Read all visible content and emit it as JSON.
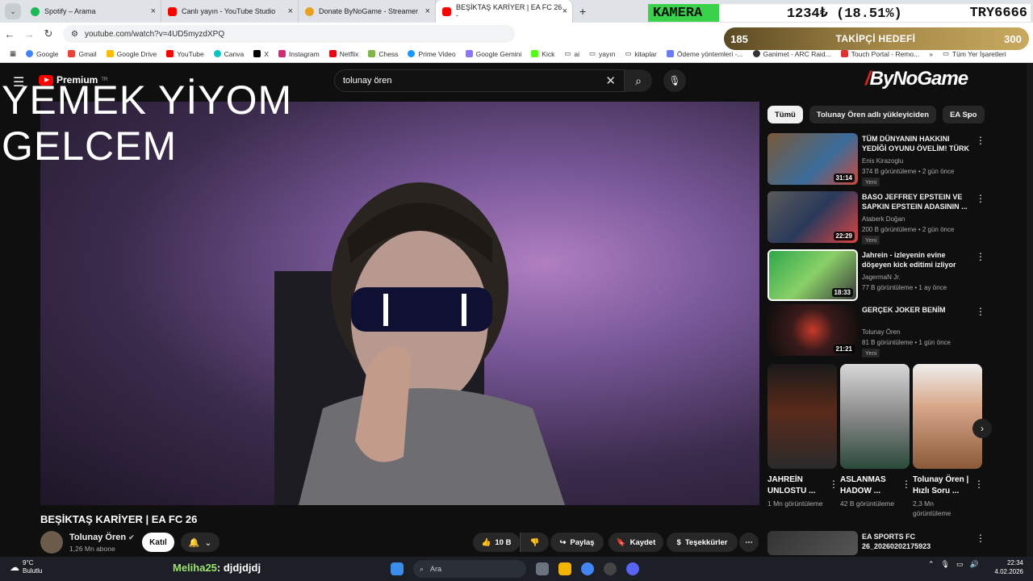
{
  "browser": {
    "tabs": [
      {
        "title": "Spotify – Arama",
        "color": "#1db954"
      },
      {
        "title": "Canlı yayın - YouTube Studio",
        "color": "#ff0000"
      },
      {
        "title": "Donate ByNoGame - Streamer",
        "color": "#e8a020"
      },
      {
        "title": "BEŞİKTAŞ KARİYER | EA FC 26 -",
        "color": "#ff0000"
      }
    ],
    "url": "youtube.com/watch?v=4UD5myzdXPQ",
    "bookmarks": [
      "Google",
      "Gmail",
      "Google Drive",
      "YouTube",
      "Canva",
      "X",
      "Instagram",
      "Netflix",
      "Chess",
      "Prime Video",
      "Google Gemini",
      "Kick",
      "ai",
      "yayın",
      "kitaplar",
      "Ödeme yöntemleri -...",
      "Ganimet - ARC Raid...",
      "Touch Portal - Remo..."
    ],
    "bookmarks_more": "»",
    "all_bookmarks": "Tüm Yer İşaretleri"
  },
  "overlay": {
    "kamera_label": "KAMERA",
    "kamera_value": "1234₺ (18.51%)",
    "kamera_currency": "TRY6666",
    "goal_current": "185",
    "goal_label": "TAKİPÇİ HEDEFİ",
    "goal_target": "300",
    "big_text_line1": "YEMEK YİYOM",
    "big_text_line2": "GELCEM",
    "bynogame_logo": "ByNoGame"
  },
  "youtube": {
    "logo": "Premium",
    "logo_region": "TR",
    "search_query": "tolunay ören",
    "video_title": "BEŞİKTAŞ KARİYER | EA FC 26",
    "channel_name": "Tolunay Ören",
    "channel_subs": "1,26 Mn abone",
    "join_label": "Katıl",
    "likes": "10 B",
    "share_label": "Paylaş",
    "save_label": "Kaydet",
    "thanks_label": "Teşekkürler",
    "chips": [
      "Tümü",
      "Tolunay Ören adlı yükleyiciden",
      "EA Spo"
    ],
    "recommendations": [
      {
        "title": "TÜM DÜNYANIN HAKKINI YEDİĞİ OYUNU ÖVELİM! TÜRK ...",
        "channel": "Enis Kirazoglu",
        "meta": "374 B görüntüleme • 2 gün önce",
        "badge": "Yeni",
        "duration": "31:14"
      },
      {
        "title": "BASO JEFFREY EPSTEIN VE SAPKIN EPSTEIN ADASININ ...",
        "channel": "Ataberk Doğan",
        "meta": "200 B görüntüleme • 2 gün önce",
        "badge": "Yeni",
        "duration": "22:29"
      },
      {
        "title": "Jahrein - izleyenin evine döşeyen kick editimi izliyor",
        "channel": "JagermaN Jr.",
        "meta": "77 B görüntüleme • 1 ay önce",
        "badge": "",
        "duration": "18:33"
      },
      {
        "title": "GERÇEK JOKER BENİM",
        "channel": "Tolunay Ören",
        "meta": "81 B görüntüleme • 1 gün önce",
        "badge": "Yeni",
        "duration": "21:21"
      }
    ],
    "shorts": [
      {
        "title": "JAHREİN UNLOSTU ...",
        "views": "1 Mn görüntüleme"
      },
      {
        "title": "ASLANMAS HADOW ...",
        "views": "42 B görüntüleme"
      },
      {
        "title": "Tolunay Ören | Hızlı Soru ...",
        "views": "2,3 Mn görüntüleme"
      }
    ],
    "last_rec": {
      "title": "EA SPORTS FC 26_20260202175923"
    }
  },
  "taskbar": {
    "temp": "9°C",
    "weather": "Bulutlu",
    "chat_user": "Meliha25",
    "chat_msg": ": djdjdjdj",
    "search_label": "Ara",
    "time": "22:34",
    "date": "4.02.2026"
  }
}
